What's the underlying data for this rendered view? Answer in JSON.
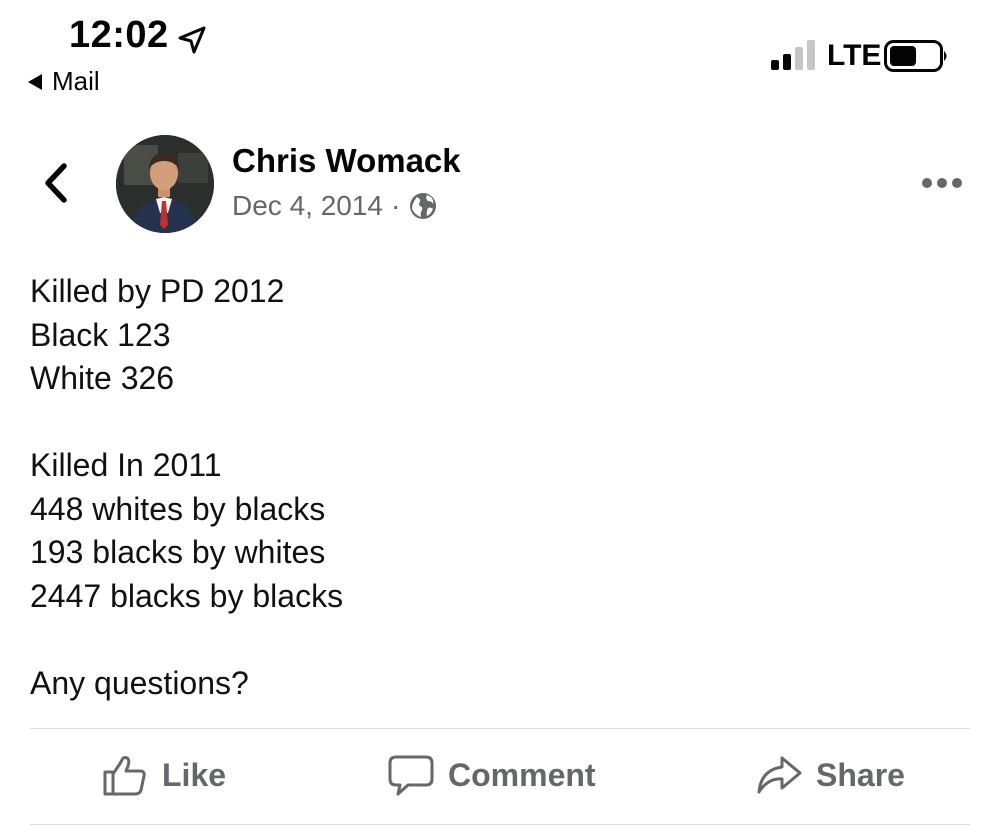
{
  "status_bar": {
    "time": "12:02",
    "back_label": "Mail",
    "network": "LTE",
    "icons": [
      "location-arrow-icon",
      "signal-bars-icon",
      "battery-icon"
    ]
  },
  "post": {
    "author": "Chris Womack",
    "date": "Dec 4, 2014",
    "separator": "·",
    "audience_icon": "globe-icon",
    "body_lines": [
      "Killed by PD 2012",
      "Black 123",
      "White 326",
      "",
      "Killed In 2011",
      "448 whites by blacks",
      "193 blacks by whites",
      "2447 blacks by blacks",
      "",
      "Any questions?"
    ]
  },
  "actions": {
    "like": "Like",
    "comment": "Comment",
    "share": "Share"
  },
  "colors": {
    "text": "#050505",
    "secondary": "#65676b",
    "divider": "#dcdde1"
  }
}
